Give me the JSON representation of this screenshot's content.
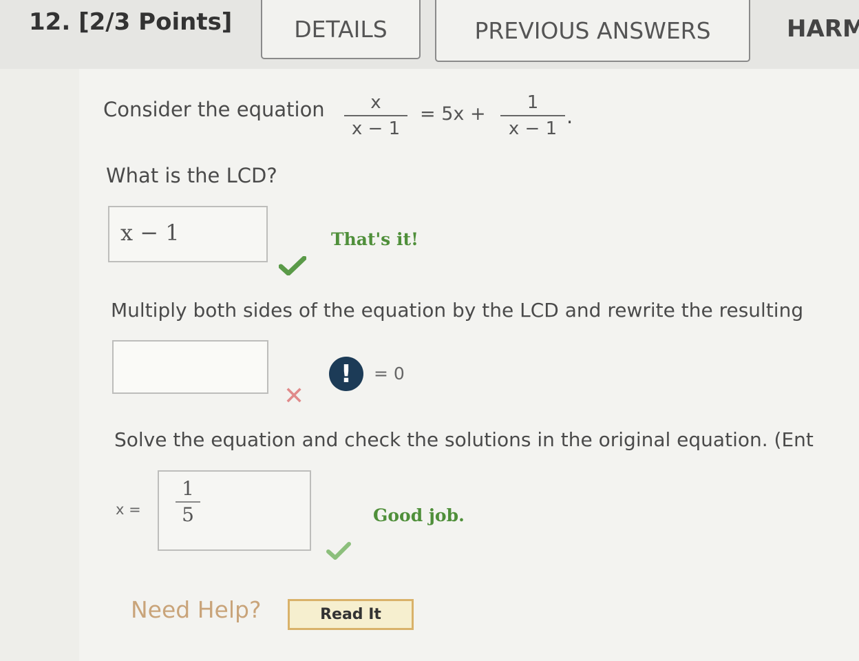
{
  "header": {
    "question_label": "12. [2/3 Points]",
    "details_tab": "DETAILS",
    "previous_answers_tab": "PREVIOUS ANSWERS",
    "partial_tab": "HARM"
  },
  "problem": {
    "intro": "Consider the equation",
    "lhs_numerator": "x",
    "lhs_denominator": "x − 1",
    "middle": "= 5x +",
    "rhs_numerator": "1",
    "rhs_denominator": "x − 1",
    "end_period": "."
  },
  "part1": {
    "prompt": "What is the LCD?",
    "answer": "x − 1",
    "feedback": "That's it!"
  },
  "part2": {
    "prompt": "Multiply both sides of the equation by the LCD and rewrite the resulting",
    "answer": "",
    "alert_symbol": "!",
    "equals_zero": "= 0"
  },
  "part3": {
    "prompt": "Solve the equation and check the solutions in the original equation. (Ent",
    "x_label": "x =",
    "answer_numerator": "1",
    "answer_denominator": "5",
    "feedback": "Good job."
  },
  "help": {
    "label": "Need Help?",
    "read_it": "Read It"
  },
  "colors": {
    "correct": "#4f8f3a",
    "incorrect": "#e08a8a",
    "alert": "#1c3b57"
  }
}
